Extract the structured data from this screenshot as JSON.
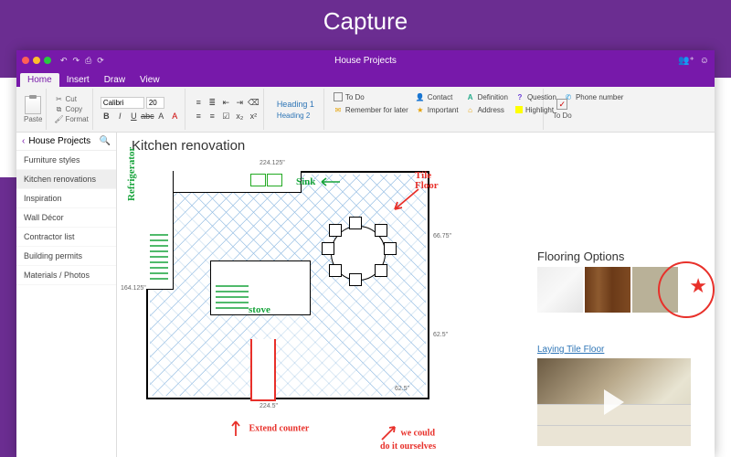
{
  "hero": "Capture",
  "titlebar": {
    "title": "House Projects"
  },
  "tabs": [
    "Home",
    "Insert",
    "Draw",
    "View"
  ],
  "active_tab": 0,
  "ribbon": {
    "paste": "Paste",
    "clipboard": {
      "cut": "Cut",
      "copy": "Copy",
      "format": "Format"
    },
    "font": {
      "family": "Calibri",
      "size": "20"
    },
    "styles": {
      "h1": "Heading 1",
      "h2": "Heading 2"
    },
    "tags": [
      {
        "icon": "☐",
        "color": "#666",
        "label": "To Do"
      },
      {
        "icon": "✉",
        "color": "#e6a100",
        "label": "Remember for later"
      },
      {
        "icon": "👤",
        "color": "#4a7",
        "label": "Contact"
      },
      {
        "icon": "★",
        "color": "#e6a100",
        "label": "Important"
      },
      {
        "icon": "A",
        "color": "#2a8",
        "label": "Definition"
      },
      {
        "icon": "⌂",
        "color": "#e6a100",
        "label": "Address"
      },
      {
        "icon": "?",
        "color": "#6a3bd6",
        "label": "Question"
      },
      {
        "icon": "▍",
        "color": "#e6e600",
        "label": "Highlight"
      },
      {
        "icon": "✆",
        "color": "#29d",
        "label": "Phone number"
      }
    ],
    "todo": "To Do"
  },
  "sidebar": {
    "back": "‹",
    "notebook": "House Projects",
    "items": [
      "Furniture styles",
      "Kitchen renovations",
      "Inspiration",
      "Wall Décor",
      "Contractor list",
      "Building permits",
      "Materials / Photos"
    ],
    "active": 1
  },
  "page": {
    "title": "Kitchen renovation",
    "dims": {
      "top": "224.125\"",
      "left": "164.125\"",
      "right_upper": "66.75\"",
      "right_lower": "62.5\"",
      "bottom": "224.5\"",
      "cut": "62.5\""
    },
    "annotations": {
      "refrigerator": "Refrigerator",
      "sink": "Sink",
      "stove": "stove",
      "tile_floor": "Tile\nFloor",
      "extend": "Extend counter",
      "diy": "we could\ndo it ourselves"
    },
    "flooring": {
      "title": "Flooring Options"
    },
    "video": {
      "link": "Laying Tile Floor"
    }
  }
}
